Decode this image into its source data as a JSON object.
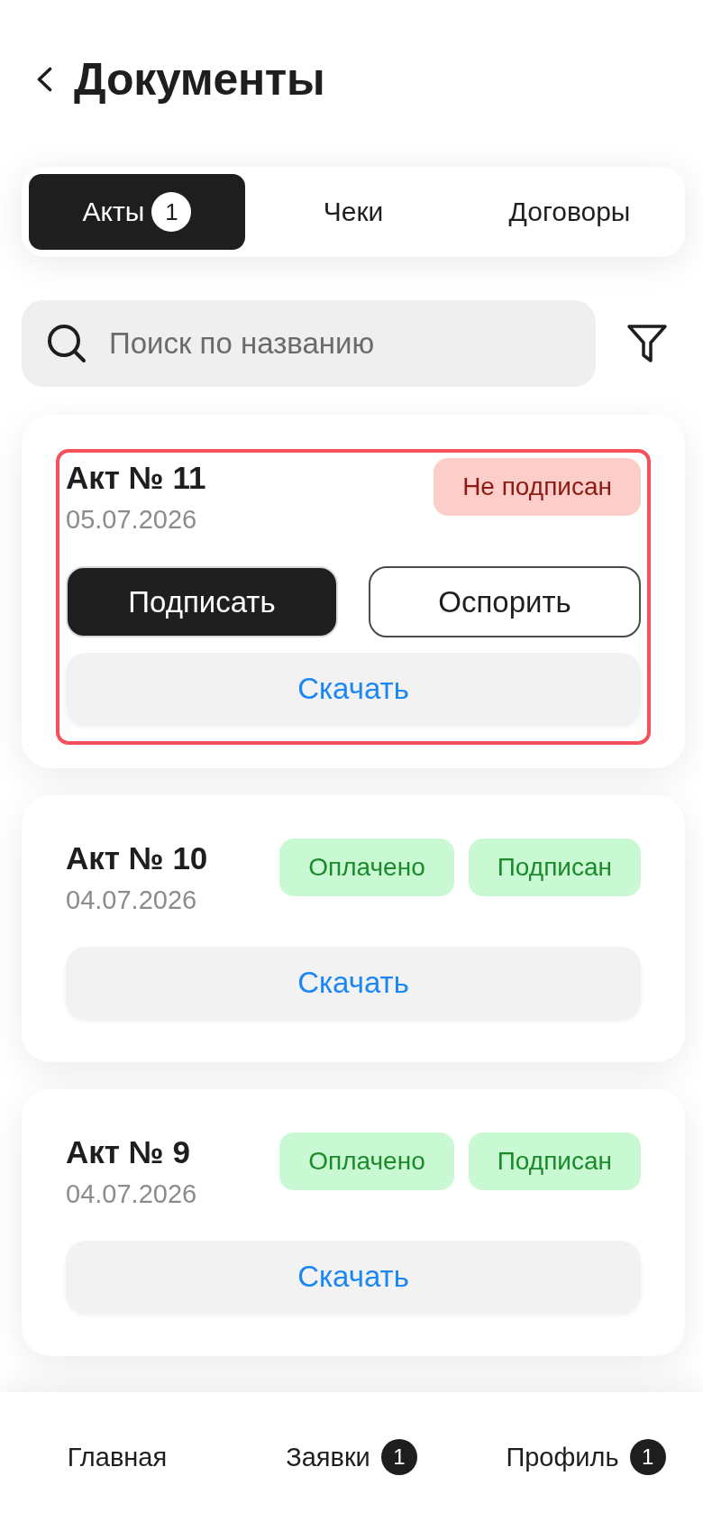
{
  "header": {
    "title": "Документы"
  },
  "tabs": [
    {
      "label": "Акты",
      "selected": true,
      "badge": "1"
    },
    {
      "label": "Чеки",
      "selected": false
    },
    {
      "label": "Договоры",
      "selected": false
    }
  ],
  "search": {
    "placeholder": "Поиск по названию"
  },
  "documents": [
    {
      "title": "Акт № 11",
      "date": "05.07.2026",
      "highlighted": true,
      "statuses": [
        {
          "label": "Не подписан",
          "kind": "negative"
        }
      ],
      "actions": [
        {
          "label": "Подписать",
          "kind": "primary"
        },
        {
          "label": "Оспорить",
          "kind": "outline"
        }
      ],
      "download": "Скачать"
    },
    {
      "title": "Акт № 10",
      "date": "04.07.2026",
      "highlighted": false,
      "statuses": [
        {
          "label": "Оплачено",
          "kind": "positive"
        },
        {
          "label": "Подписан",
          "kind": "positive"
        }
      ],
      "download": "Скачать"
    },
    {
      "title": "Акт № 9",
      "date": "04.07.2026",
      "highlighted": false,
      "statuses": [
        {
          "label": "Оплачено",
          "kind": "positive"
        },
        {
          "label": "Подписан",
          "kind": "positive"
        }
      ],
      "download": "Скачать"
    }
  ],
  "bottom_nav": [
    {
      "label": "Главная"
    },
    {
      "label": "Заявки",
      "badge": "1"
    },
    {
      "label": "Профиль",
      "badge": "1"
    }
  ]
}
